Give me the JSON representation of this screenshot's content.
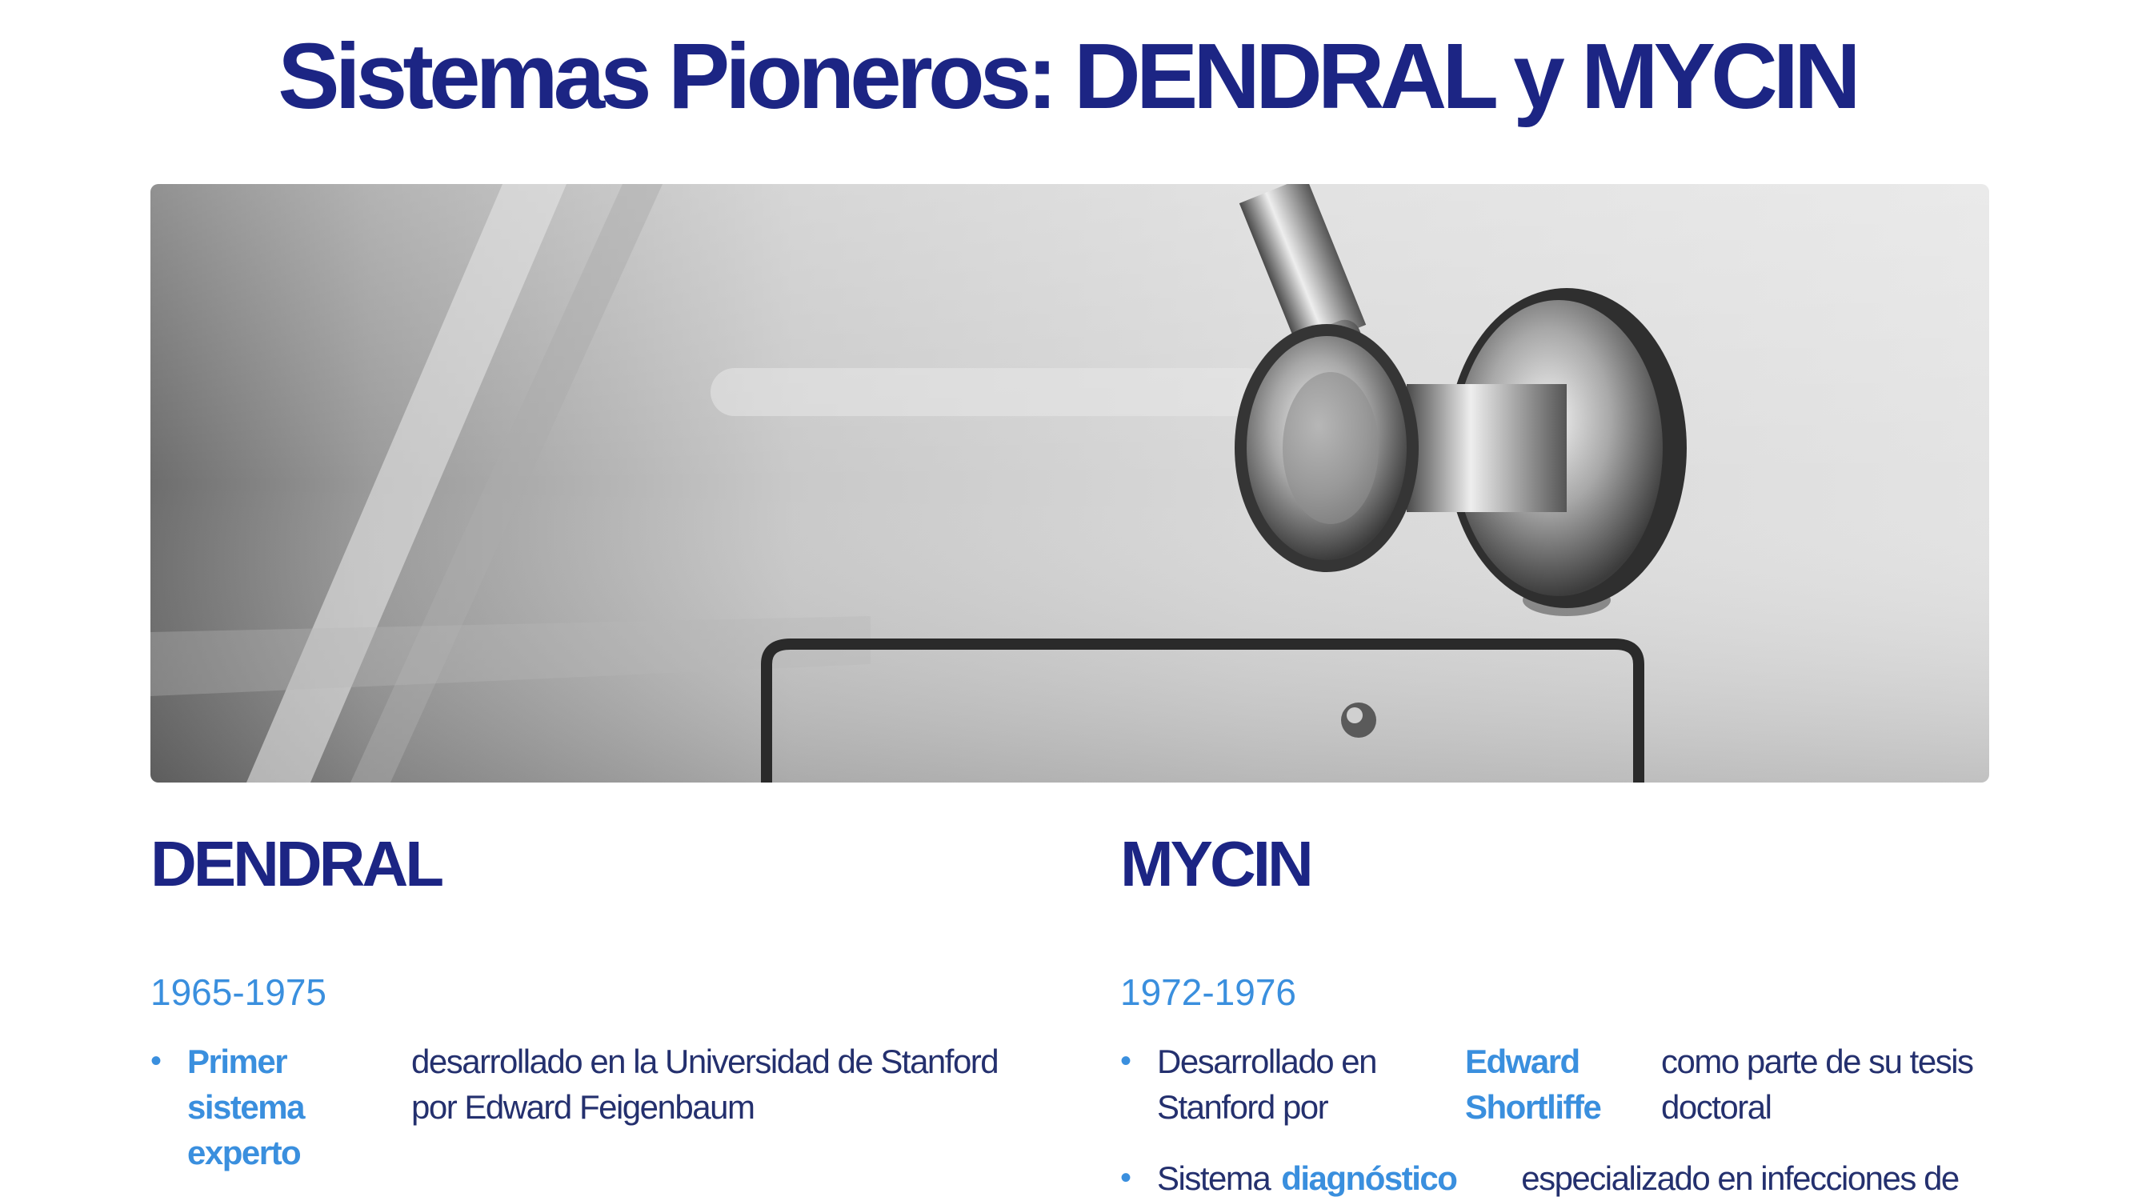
{
  "title": "Sistemas Pioneros: DENDRAL y MYCIN",
  "image": {
    "icon": "stethoscope-photo",
    "alt": "Estetoscopio"
  },
  "dendral": {
    "heading": "DENDRAL",
    "years": "1965-1975",
    "bullet1": {
      "highlight": "Primer sistema experto",
      "text": "desarrollado en la Universidad de Stanford por Edward Feigenbaum"
    }
  },
  "mycin": {
    "heading": "MYCIN",
    "years": "1972-1976",
    "bullet1": {
      "text_before": "Desarrollado en Stanford por",
      "highlight": "Edward Shortliffe",
      "text_after": "como parte de su tesis doctoral"
    },
    "bullet2": {
      "text_before": "Sistema",
      "highlight": "diagnóstico",
      "text_after": "especializado en infecciones de"
    }
  },
  "colors": {
    "title": "#1c2584",
    "accent": "#3a8fde",
    "body": "#24306e"
  }
}
